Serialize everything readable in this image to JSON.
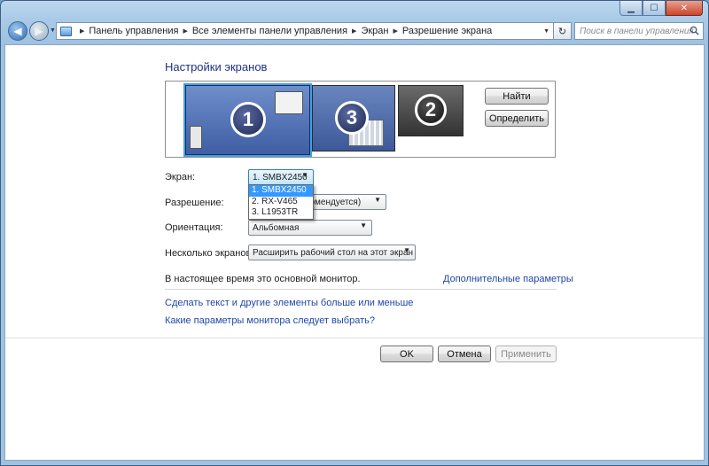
{
  "window": {
    "minimize_glyph": "▁",
    "maximize_glyph": "☐",
    "close_glyph": "✕"
  },
  "navbar": {
    "back_glyph": "◀",
    "forward_glyph": "▶",
    "history_glyph": "▼",
    "breadcrumbs": [
      "Панель управления",
      "Все элементы панели управления",
      "Экран",
      "Разрешение экрана"
    ],
    "crumb_sep_glyph": "▶",
    "dropdown_glyph": "▼",
    "refresh_glyph": "↻",
    "search_placeholder": "Поиск в панели управления"
  },
  "page": {
    "title": "Настройки экранов"
  },
  "preview": {
    "monitors": [
      "1",
      "3",
      "2"
    ],
    "find_button": "Найти",
    "identify_button": "Определить"
  },
  "form": {
    "screen_label": "Экран:",
    "screen_value": "1. SMBX2450",
    "screen_options": [
      "1. SMBX2450",
      "2. RX-V465",
      "3. L1953TR"
    ],
    "resolution_label": "Разрешение:",
    "resolution_value": "комендуется)",
    "orientation_label": "Ориентация:",
    "orientation_value": "Альбомная",
    "multiple_label": "Несколько экранов:",
    "multiple_value": "Расширить рабочий стол на этот экран",
    "combo_arrow_glyph": "▼"
  },
  "status": {
    "primary_monitor_text": "В настоящее время это основной монитор.",
    "advanced_link": "Дополнительные параметры"
  },
  "links": {
    "text_size": "Сделать текст и другие элементы больше или меньше",
    "which_settings": "Какие параметры монитора следует выбрать?"
  },
  "footer": {
    "ok": "OK",
    "cancel": "Отмена",
    "apply": "Применить"
  }
}
